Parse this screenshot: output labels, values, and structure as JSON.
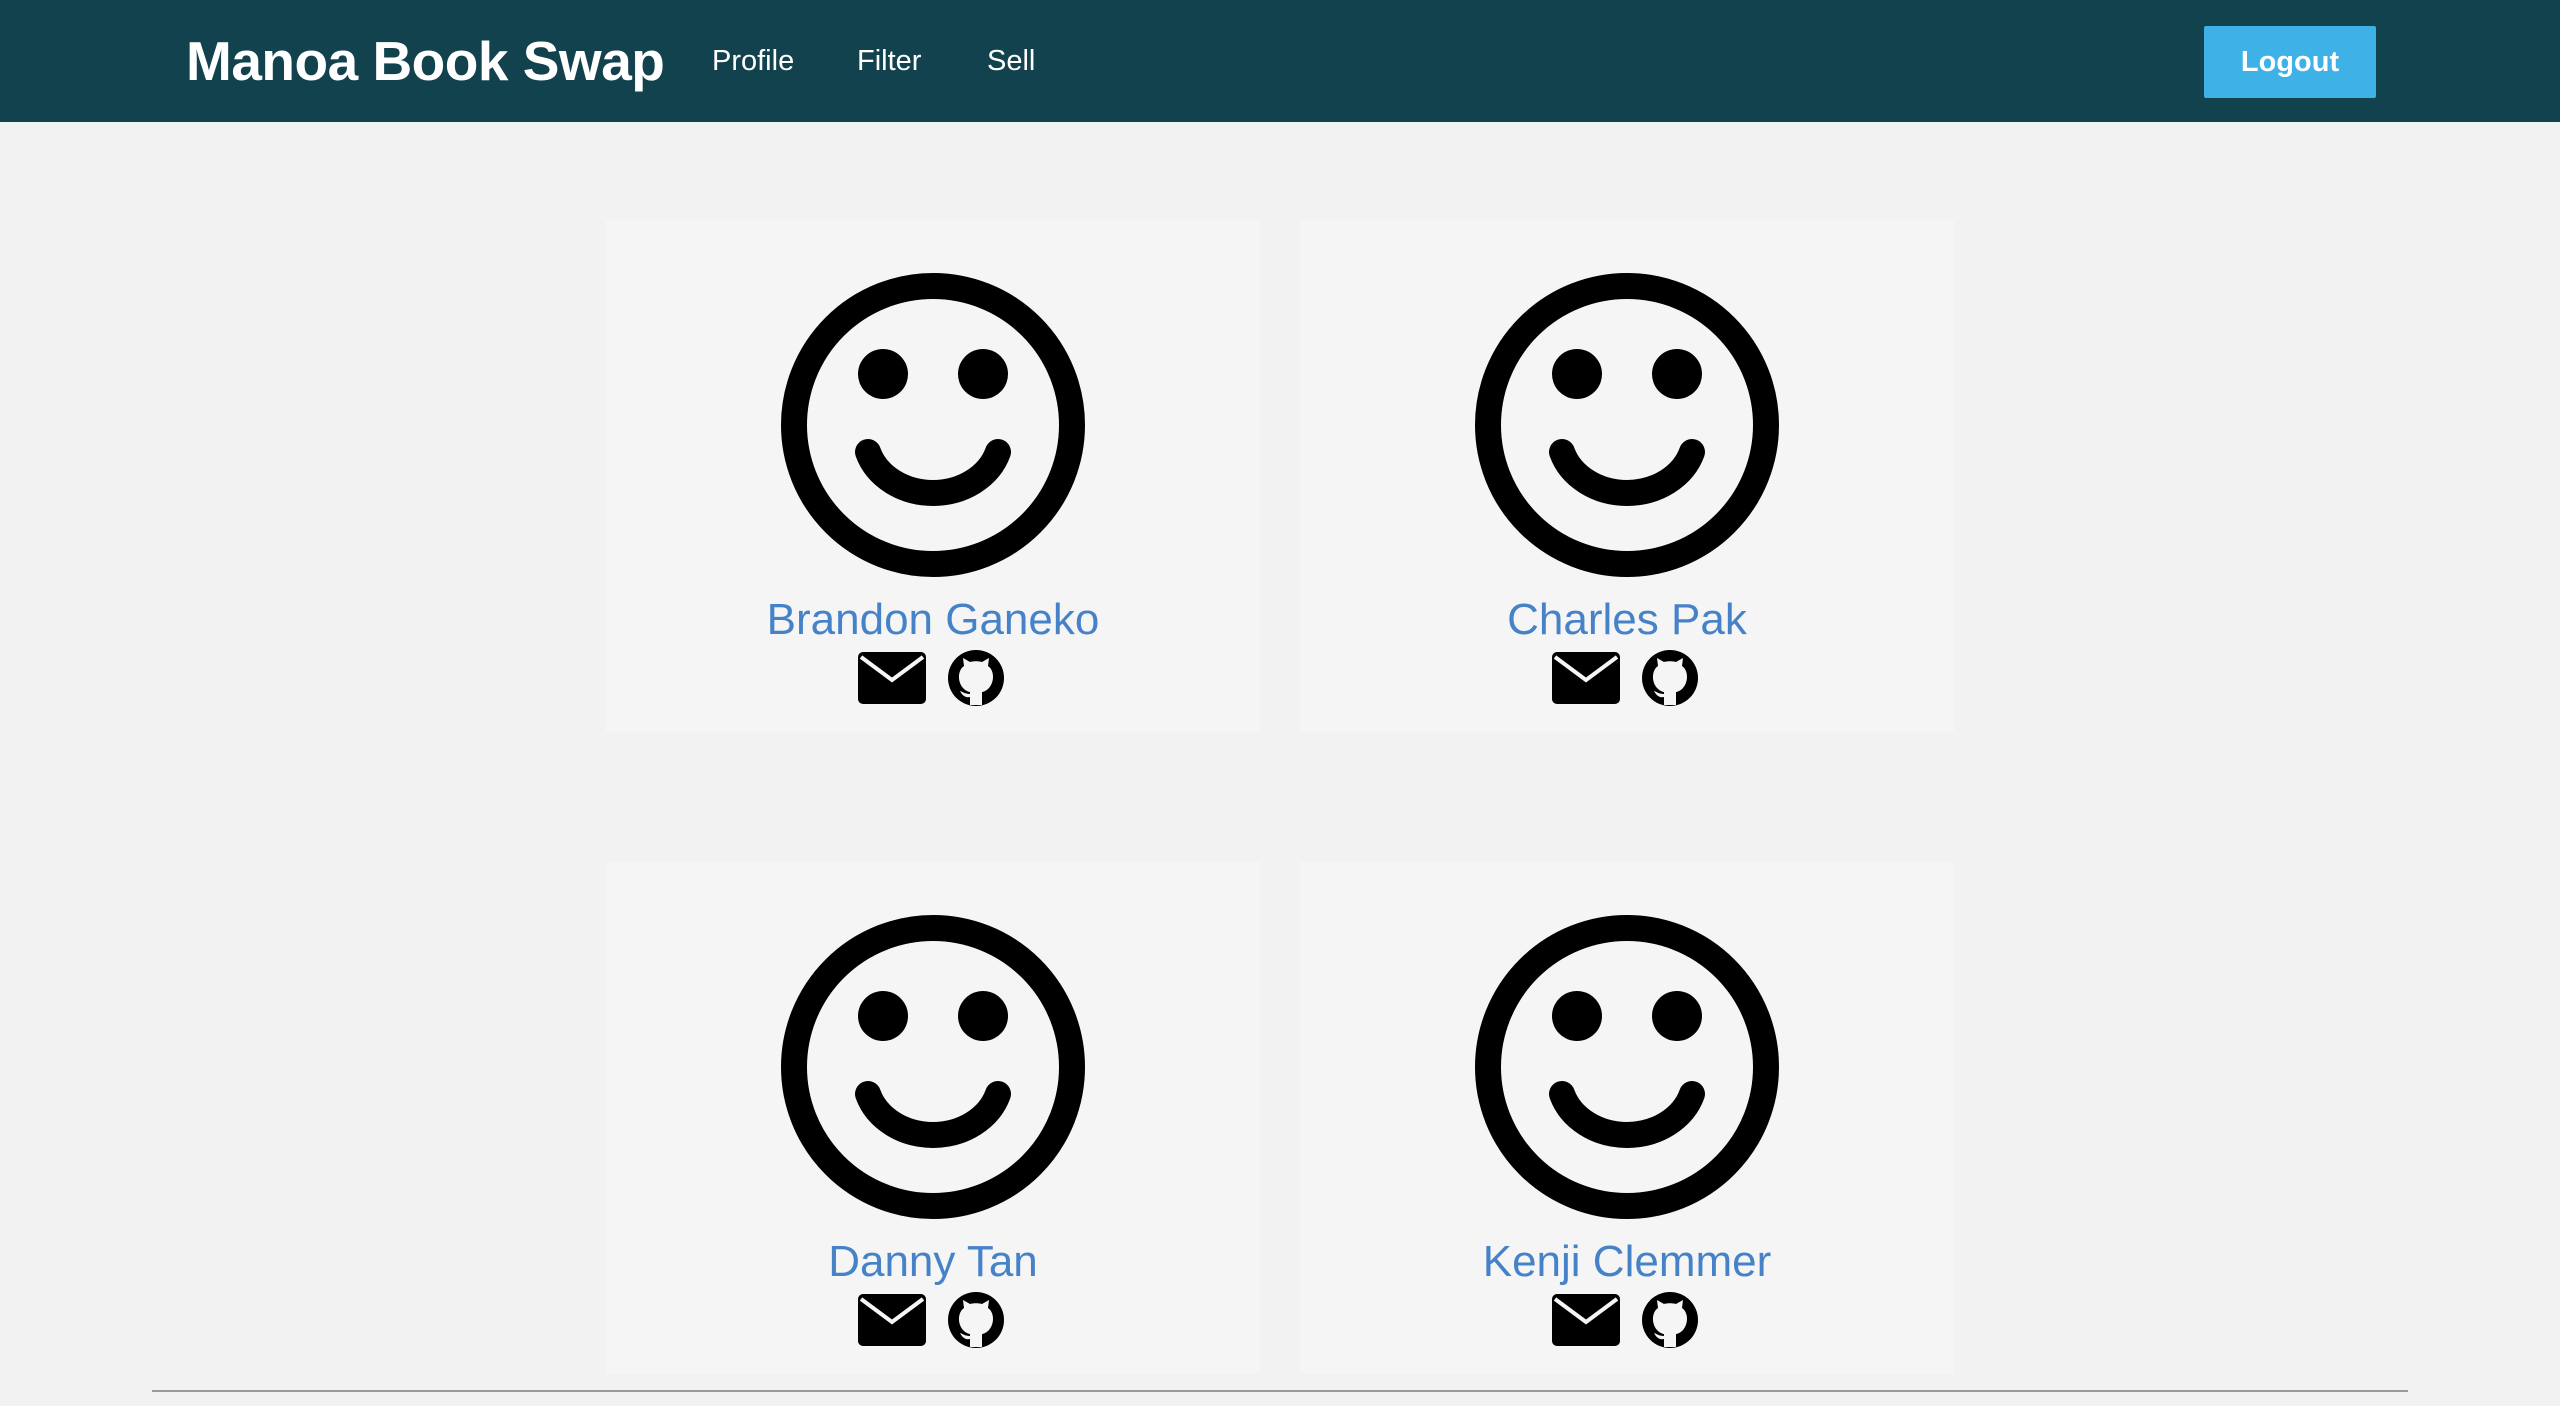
{
  "navbar": {
    "brand": "Manoa Book Swap",
    "links": [
      "Profile",
      "Filter",
      "Sell"
    ],
    "logout_label": "Logout",
    "bg_color": "#11424e",
    "logout_color": "#3eb1e6"
  },
  "people": [
    {
      "name": "Brandon Ganeko",
      "icons": [
        "mail-icon",
        "github-icon"
      ]
    },
    {
      "name": "Charles Pak",
      "icons": [
        "mail-icon",
        "github-icon"
      ]
    },
    {
      "name": "Danny Tan",
      "icons": [
        "mail-icon",
        "github-icon"
      ]
    },
    {
      "name": "Kenji Clemmer",
      "icons": [
        "mail-icon",
        "github-icon"
      ]
    }
  ],
  "colors": {
    "name_link": "#4682c8",
    "page_bg": "#f2f2f2",
    "card_bg": "#f5f5f5"
  }
}
